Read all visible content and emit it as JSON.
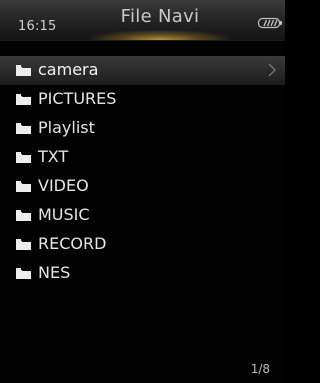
{
  "status_bar": {
    "time": "16:15",
    "title": "File Navi",
    "battery_icon": "battery-icon",
    "battery_level": 1.0
  },
  "colors": {
    "header_glow": "#d7aa3c",
    "background": "#020202",
    "selected_row": "#2a2a2a",
    "text": "#e6e6e6"
  },
  "file_list": {
    "selected_index": 0,
    "items": [
      {
        "label": "camera",
        "icon": "folder-icon"
      },
      {
        "label": "PICTURES",
        "icon": "folder-icon"
      },
      {
        "label": "Playlist",
        "icon": "folder-icon"
      },
      {
        "label": "TXT",
        "icon": "folder-icon"
      },
      {
        "label": "VIDEO",
        "icon": "folder-icon"
      },
      {
        "label": "MUSIC",
        "icon": "folder-icon"
      },
      {
        "label": "RECORD",
        "icon": "folder-icon"
      },
      {
        "label": "NES",
        "icon": "folder-icon"
      }
    ]
  },
  "pager": {
    "text": "1/8"
  }
}
